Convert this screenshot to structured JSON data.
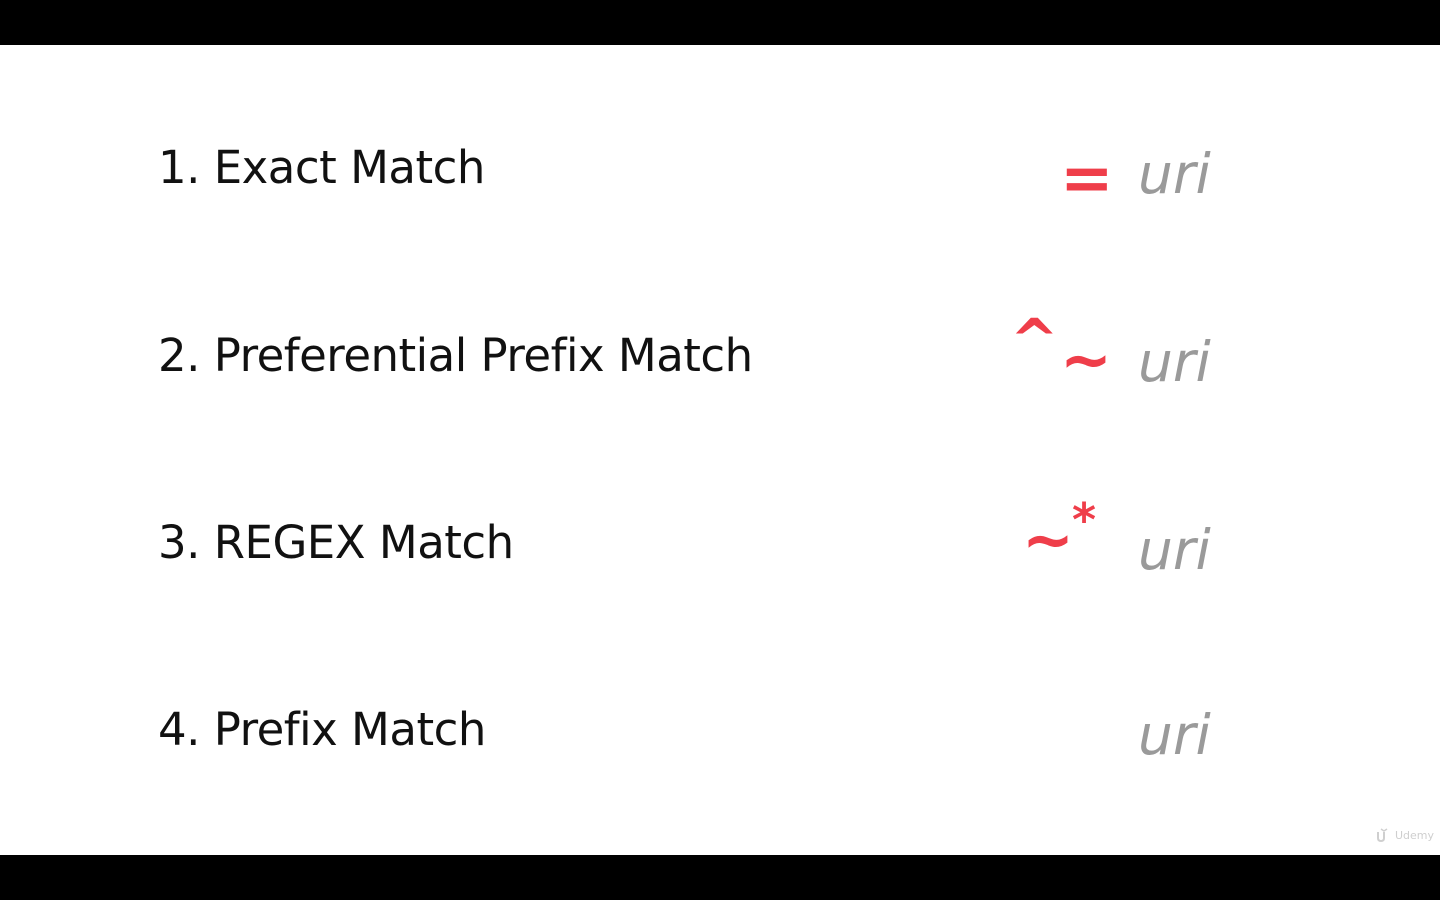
{
  "slide": {
    "items": [
      {
        "label": "1. Exact Match",
        "modifier": "=",
        "target": "uri"
      },
      {
        "label": "2. Preferential Prefix Match",
        "modifier_caret": "^",
        "modifier_tilde": "~",
        "target": "uri"
      },
      {
        "label": "3. REGEX Match",
        "modifier_tilde": "~",
        "modifier_star": "*",
        "target": "uri"
      },
      {
        "label": "4. Prefix Match",
        "target": "uri"
      }
    ]
  },
  "watermark": {
    "text": "Udemy",
    "icon": "udemy-logo"
  },
  "colors": {
    "accent": "#ef3e4a",
    "uri_text": "#9a9a9a",
    "label_text": "#111111",
    "background": "#ffffff",
    "letterbox": "#000000"
  }
}
